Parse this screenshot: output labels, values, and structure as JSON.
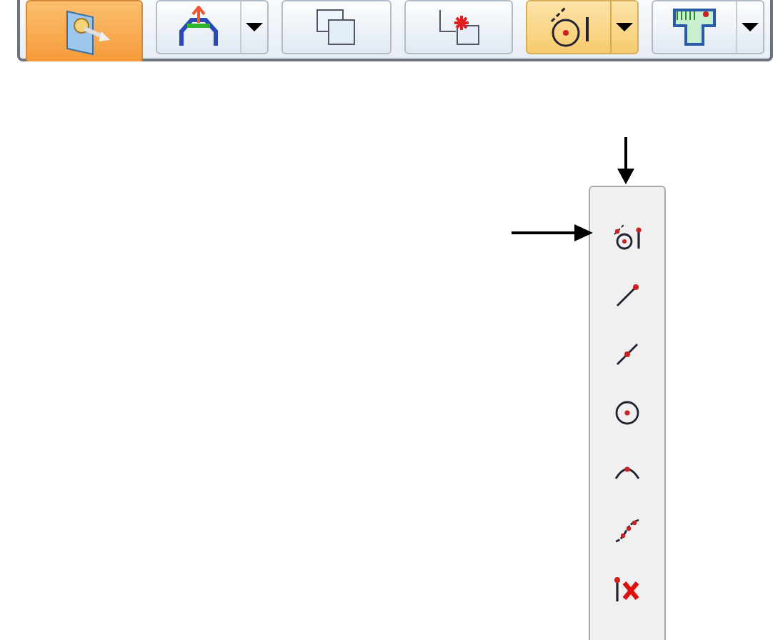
{
  "toolbar": {
    "buttons": [
      {
        "kind": "button",
        "selected": true
      },
      {
        "kind": "split",
        "selected": false,
        "expanded": false
      },
      {
        "kind": "button",
        "selected": false
      },
      {
        "kind": "button",
        "selected": false
      },
      {
        "kind": "split",
        "selected": false,
        "expanded": true
      },
      {
        "kind": "split",
        "selected": false,
        "expanded": false
      }
    ]
  },
  "dropdown": {
    "items": [
      {
        "kind": "auto"
      },
      {
        "kind": "endpoint"
      },
      {
        "kind": "midpoint"
      },
      {
        "kind": "center"
      },
      {
        "kind": "tangent"
      },
      {
        "kind": "curve"
      },
      {
        "kind": "off"
      }
    ]
  }
}
